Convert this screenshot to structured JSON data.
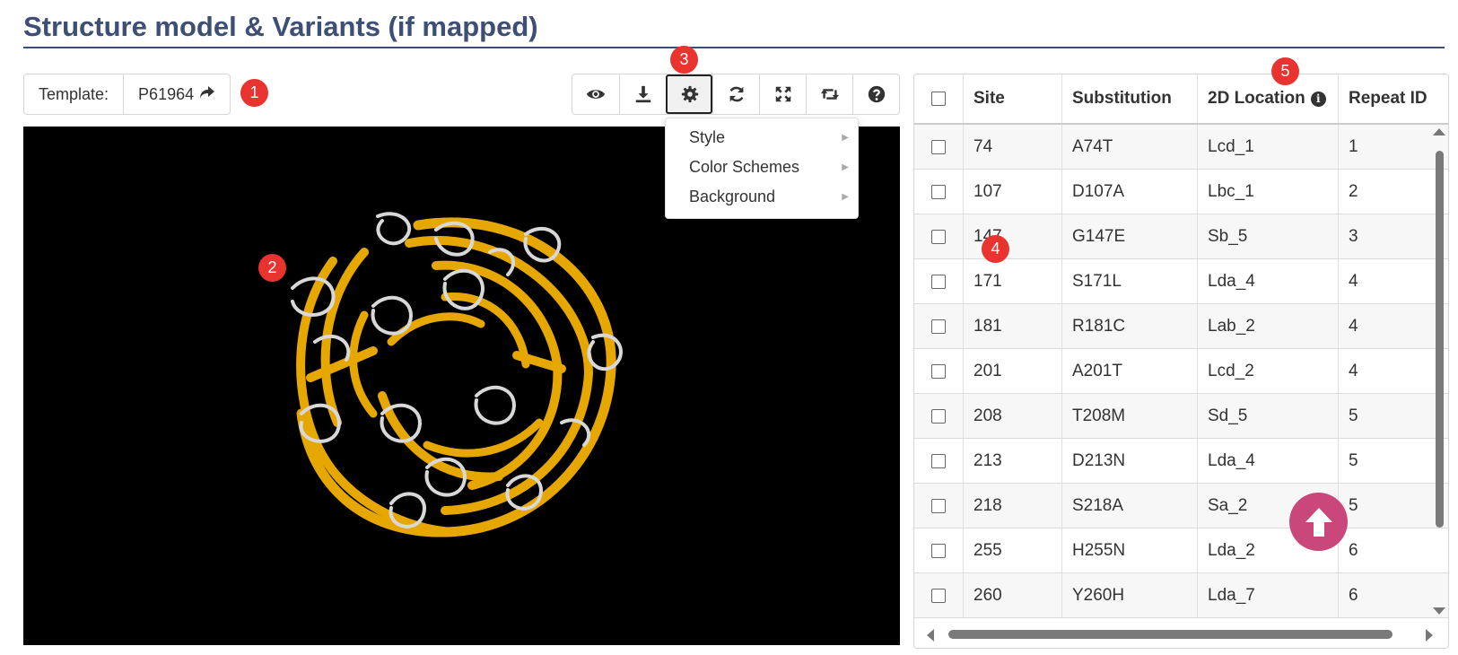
{
  "page": {
    "title": "Structure model & Variants (if mapped)"
  },
  "template": {
    "label": "Template:",
    "value": "P61964",
    "arrow": "↪"
  },
  "badges": [
    "1",
    "2",
    "3",
    "4",
    "5"
  ],
  "toolbar": {
    "buttons": [
      {
        "icon": "eye-icon"
      },
      {
        "icon": "download-icon"
      },
      {
        "icon": "gear-icon"
      },
      {
        "icon": "refresh-icon"
      },
      {
        "icon": "expand-icon"
      },
      {
        "icon": "retweet-icon"
      },
      {
        "icon": "question-icon"
      }
    ]
  },
  "settings_menu": {
    "items": [
      {
        "label": "Style"
      },
      {
        "label": "Color Schemes"
      },
      {
        "label": "Background"
      }
    ]
  },
  "table": {
    "headers": {
      "site": "Site",
      "substitution": "Substitution",
      "location": "2D Location",
      "repeat": "Repeat ID"
    },
    "rows": [
      {
        "site": "74",
        "substitution": "A74T",
        "location": "Lcd_1",
        "repeat": "1"
      },
      {
        "site": "107",
        "substitution": "D107A",
        "location": "Lbc_1",
        "repeat": "2"
      },
      {
        "site": "147",
        "substitution": "G147E",
        "location": "Sb_5",
        "repeat": "3"
      },
      {
        "site": "171",
        "substitution": "S171L",
        "location": "Lda_4",
        "repeat": "4"
      },
      {
        "site": "181",
        "substitution": "R181C",
        "location": "Lab_2",
        "repeat": "4"
      },
      {
        "site": "201",
        "substitution": "A201T",
        "location": "Lcd_2",
        "repeat": "4"
      },
      {
        "site": "208",
        "substitution": "T208M",
        "location": "Sd_5",
        "repeat": "5"
      },
      {
        "site": "213",
        "substitution": "D213N",
        "location": "Lda_4",
        "repeat": "5"
      },
      {
        "site": "218",
        "substitution": "S218A",
        "location": "Sa_2",
        "repeat": "5"
      },
      {
        "site": "255",
        "substitution": "H255N",
        "location": "Lda_2",
        "repeat": "6"
      },
      {
        "site": "260",
        "substitution": "Y260H",
        "location": "Lda_7",
        "repeat": "6"
      }
    ]
  },
  "colors": {
    "title": "#3d4f74",
    "badge": "#e8332f",
    "ribbon_strand": "#e6a800",
    "ribbon_coil": "#d8d8d8",
    "viewer_bg": "#000000",
    "scroll_top": "#c9477a"
  }
}
